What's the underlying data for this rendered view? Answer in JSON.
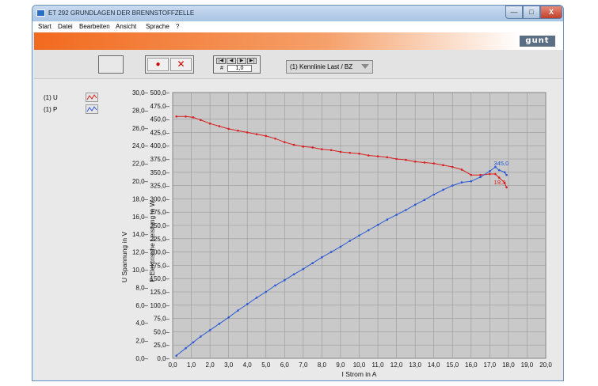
{
  "window": {
    "title": "ET 292 GRUNDLAGEN DER BRENNSTOFFZELLE",
    "controls": {
      "minimize": "—",
      "maximize": "□",
      "close": "X"
    }
  },
  "menu": [
    "Start",
    "Datei",
    "Bearbeiten",
    "Ansicht",
    "Sprache",
    "?"
  ],
  "banner": {
    "logo": "gunt"
  },
  "toolbar": {
    "record_symbol": "●",
    "stop_symbol": "✕",
    "nav_symbols": [
      "|◀",
      "◀",
      "▶",
      "▶|"
    ],
    "record_label": "#",
    "record_number": "1,0",
    "view_select": "(1) Kennlinie Last / BZ"
  },
  "legend": [
    {
      "label": "(1) U",
      "color": "#d81e1e"
    },
    {
      "label": "(1) P",
      "color": "#2a58d4"
    }
  ],
  "colors": {
    "u_series": "#d81e1e",
    "p_series": "#2a58d4",
    "plot_bg": "#c9c9c9",
    "grid": "#9a9a9a"
  },
  "chart_data": {
    "type": "line",
    "xlabel": "I Strom in A",
    "ylabel_left": "U Spannung in V",
    "ylabel_right": "P Elektrische Leistung in W",
    "xlim": [
      0,
      20
    ],
    "ylim_left": [
      0,
      30
    ],
    "ylim_right": [
      0,
      500
    ],
    "x_ticks": [
      "0,0",
      "1,0",
      "2,0",
      "3,0",
      "4,0",
      "5,0",
      "6,0",
      "7,0",
      "8,0",
      "9,0",
      "10,0",
      "11,0",
      "12,0",
      "13,0",
      "14,0",
      "15,0",
      "16,0",
      "17,0",
      "18,0",
      "19,0",
      "20,0"
    ],
    "y_left_ticks": [
      "0,0",
      "2,0",
      "4,0",
      "6,0",
      "8,0",
      "10,0",
      "12,0",
      "14,0",
      "16,0",
      "18,0",
      "20,0",
      "22,0",
      "24,0",
      "26,0",
      "28,0",
      "30,0"
    ],
    "y_right_ticks": [
      "0,0",
      "25,0",
      "50,0",
      "75,0",
      "100,0",
      "125,0",
      "150,0",
      "175,0",
      "200,0",
      "225,0",
      "250,0",
      "275,0",
      "300,0",
      "325,0",
      "350,0",
      "375,0",
      "400,0",
      "425,0",
      "450,0",
      "475,0",
      "500,0"
    ],
    "grid": true,
    "series": [
      {
        "name": "(1) U",
        "axis": "left",
        "x": [
          0.2,
          0.7,
          1.1,
          1.5,
          2.0,
          2.5,
          3.0,
          3.5,
          4.0,
          4.5,
          5.0,
          5.5,
          6.0,
          6.5,
          7.0,
          7.5,
          8.0,
          8.5,
          9.0,
          9.5,
          10.0,
          10.5,
          11.0,
          11.5,
          12.0,
          12.5,
          13.0,
          13.5,
          14.0,
          14.5,
          15.0,
          15.5,
          16.0,
          16.5,
          17.0,
          17.3,
          17.5,
          17.8,
          17.9
        ],
        "values": [
          27.3,
          27.3,
          27.2,
          26.9,
          26.5,
          26.2,
          25.9,
          25.7,
          25.5,
          25.3,
          25.1,
          24.8,
          24.4,
          24.1,
          23.9,
          23.8,
          23.6,
          23.5,
          23.3,
          23.2,
          23.1,
          22.9,
          22.8,
          22.7,
          22.5,
          22.4,
          22.2,
          22.1,
          22.0,
          21.8,
          21.6,
          21.3,
          20.7,
          20.7,
          20.8,
          20.8,
          20.4,
          19.8,
          19.3
        ],
        "annotation": "19,3"
      },
      {
        "name": "(1) P",
        "axis": "right",
        "x": [
          0.2,
          0.7,
          1.1,
          1.5,
          2.0,
          2.5,
          3.0,
          3.5,
          4.0,
          4.5,
          5.0,
          5.5,
          6.0,
          6.5,
          7.0,
          7.5,
          8.0,
          8.5,
          9.0,
          9.5,
          10.0,
          10.5,
          11.0,
          11.5,
          12.0,
          12.5,
          13.0,
          13.5,
          14.0,
          14.5,
          15.0,
          15.5,
          16.0,
          16.5,
          17.0,
          17.3,
          17.5,
          17.8,
          17.9
        ],
        "values": [
          5,
          19,
          30,
          41,
          53,
          65,
          77,
          90,
          102,
          114,
          125,
          137,
          147,
          158,
          168,
          179,
          190,
          200,
          210,
          221,
          231,
          241,
          251,
          261,
          270,
          279,
          289,
          298,
          308,
          317,
          325,
          331,
          333,
          341,
          352,
          360,
          354,
          350,
          345
        ],
        "annotation": "345,0"
      }
    ]
  }
}
